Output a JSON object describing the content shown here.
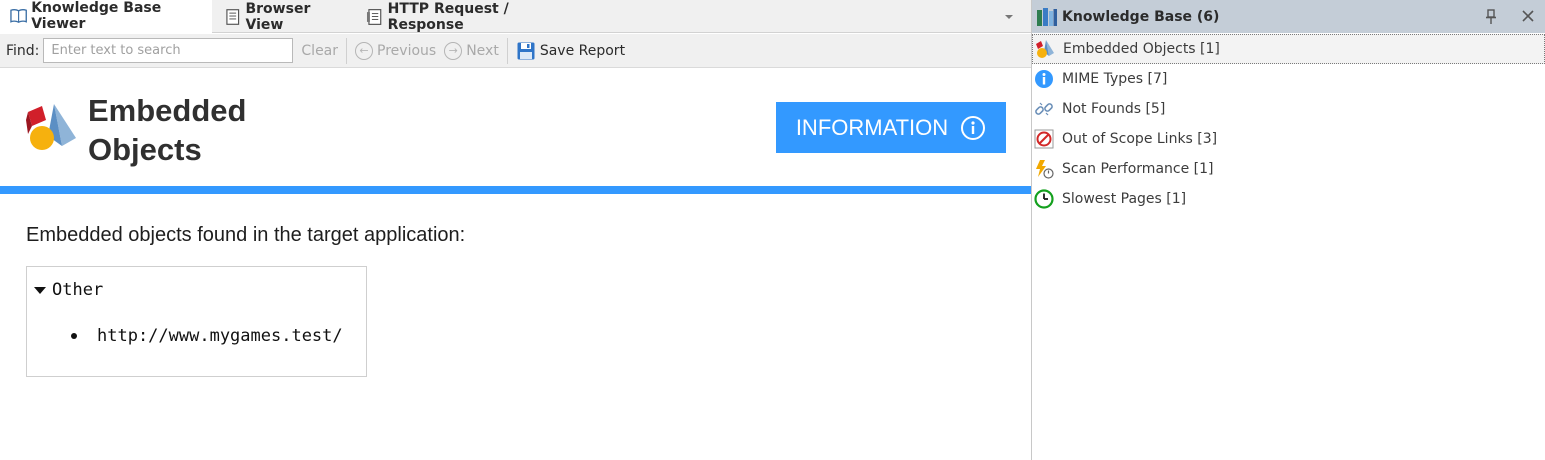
{
  "tabs": [
    {
      "label": "Knowledge Base Viewer",
      "icon": "book-icon",
      "active": true
    },
    {
      "label": "Browser View",
      "icon": "page-icon",
      "active": false
    },
    {
      "label": "HTTP Request / Response",
      "icon": "document-icon",
      "active": false
    }
  ],
  "findbar": {
    "label": "Find:",
    "placeholder": "Enter text to search",
    "value": "",
    "clear": "Clear",
    "previous": "Previous",
    "next": "Next",
    "save_report": "Save Report"
  },
  "report": {
    "title_line1": "Embedded",
    "title_line2": "Objects",
    "badge": "INFORMATION",
    "intro": "Embedded objects found in the target application:",
    "group": "Other",
    "items": [
      "http://www.mygames.test/"
    ]
  },
  "knowledge_base": {
    "title": "Knowledge Base (6)",
    "items": [
      {
        "label": "Embedded Objects [1]",
        "icon": "shapes-icon",
        "selected": true
      },
      {
        "label": "MIME Types [7]",
        "icon": "info-circle-icon",
        "selected": false
      },
      {
        "label": "Not Founds [5]",
        "icon": "broken-link-icon",
        "selected": false
      },
      {
        "label": "Out of Scope Links [3]",
        "icon": "prohibited-icon",
        "selected": false
      },
      {
        "label": "Scan Performance [1]",
        "icon": "lightning-timer-icon",
        "selected": false
      },
      {
        "label": "Slowest Pages [1]",
        "icon": "clock-icon",
        "selected": false
      }
    ]
  },
  "colors": {
    "accent": "#3399ff",
    "tab_bar": "#f0f0f0",
    "panel_header": "#c4cdd7",
    "clock_green": "#14a01e",
    "prohibited_red": "#d22828"
  }
}
